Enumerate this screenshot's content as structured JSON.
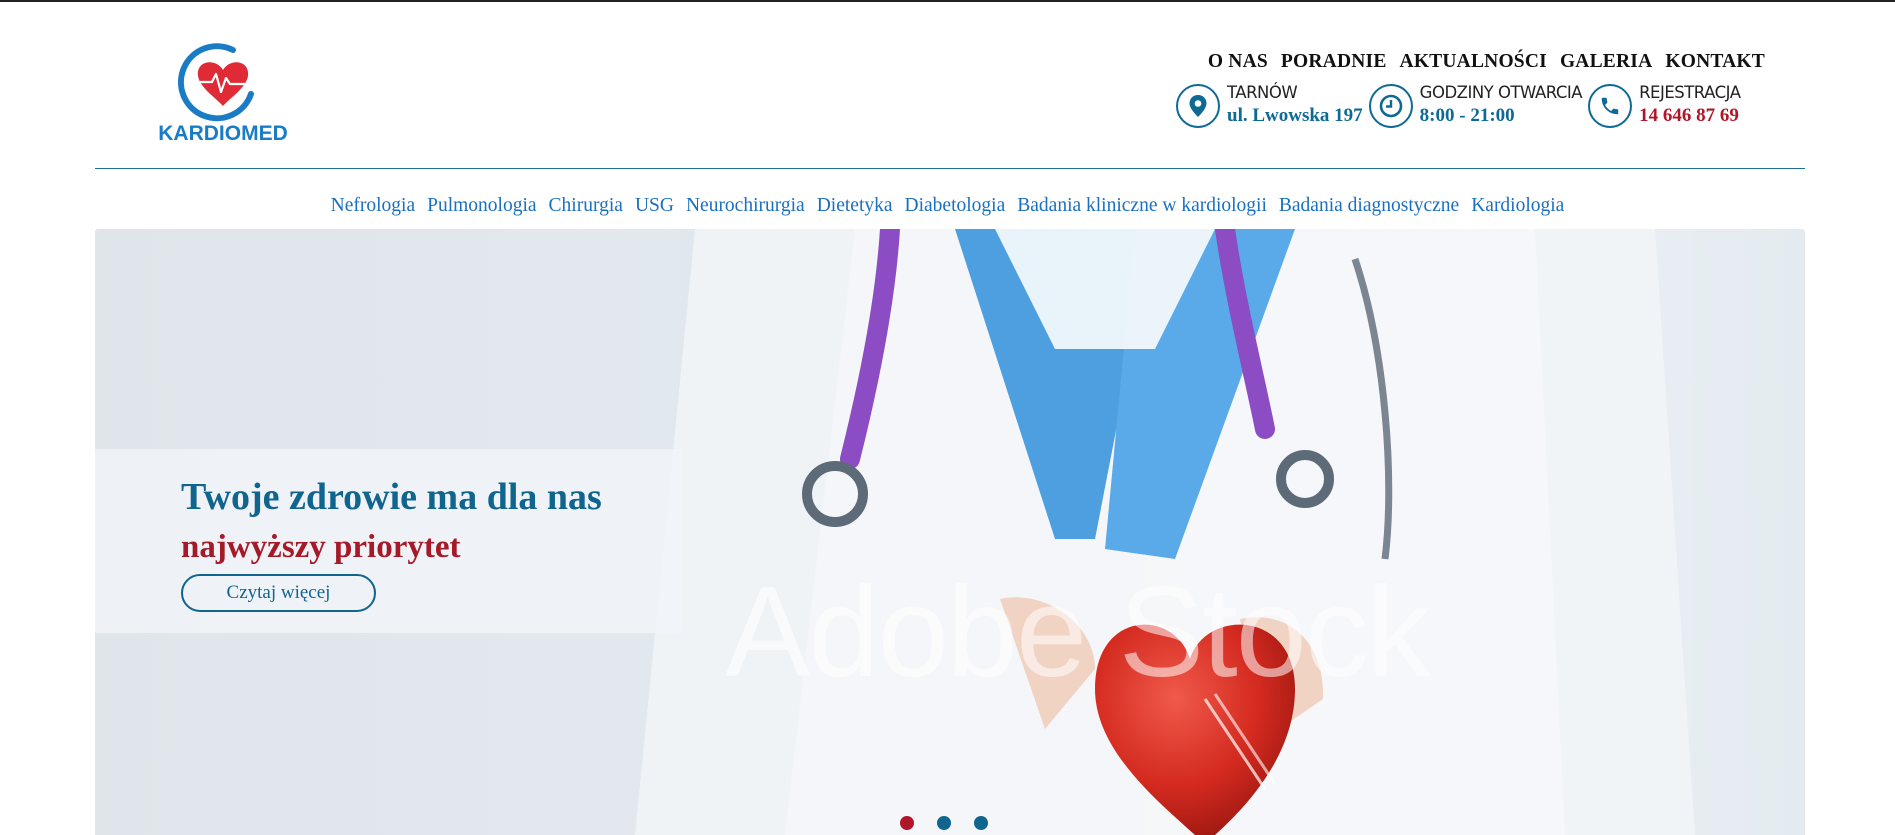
{
  "brand": {
    "name": "KARDIOMED",
    "colors": {
      "blue": "#1a7cc4",
      "red": "#e02b36"
    }
  },
  "top_nav": [
    "O NAS",
    "PORADNIE",
    "AKTUALNOŚCI",
    "GALERIA",
    "KONTAKT"
  ],
  "contacts": [
    {
      "icon": "location-pin-icon",
      "label": "TARNÓW",
      "value": "ul. Lwowska 197"
    },
    {
      "icon": "clock-icon",
      "label": "GODZINY OTWARCIA",
      "value": "8:00 - 21:00"
    },
    {
      "icon": "phone-icon",
      "label": "REJESTRACJA",
      "value": "14 646 87 69"
    }
  ],
  "sub_nav": [
    "Nefrologia",
    "Pulmonologia",
    "Chirurgia",
    "USG",
    "Neurochirurgia",
    "Dietetyka",
    "Diabetologia",
    "Badania kliniczne w kardiologii",
    "Badania diagnostyczne",
    "Kardiologia"
  ],
  "hero": {
    "title": "Twoje zdrowie ma dla nas",
    "subtitle": "najwyższy priorytet",
    "button": "Czytaj więcej",
    "watermark": "Adobe Stock",
    "slides_count": 3,
    "active_slide": 1
  },
  "colors": {
    "accent": "#0e6a95",
    "highlight": "#b0162a",
    "link": "#1a6fc0"
  }
}
